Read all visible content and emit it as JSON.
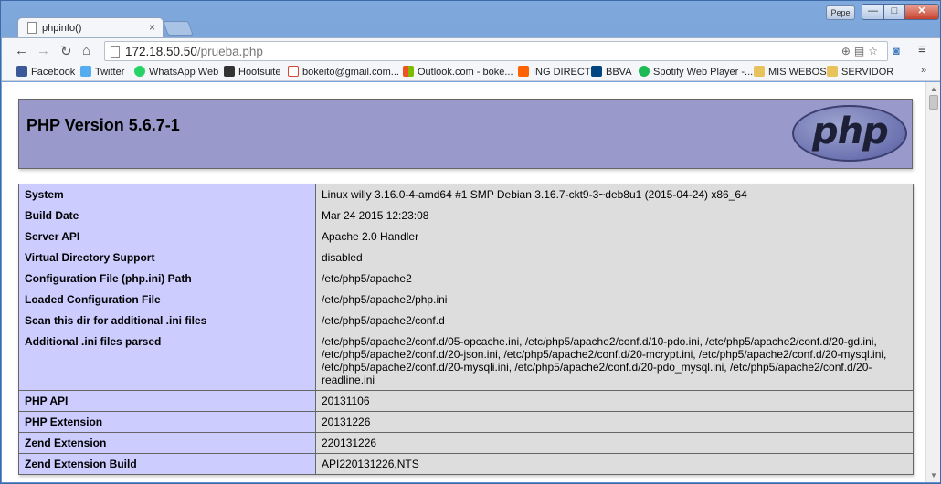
{
  "browser": {
    "tab": {
      "title": "phpinfo()",
      "close": "×"
    },
    "profile": "Pepe",
    "window_buttons": {
      "minimize": "—",
      "maximize": "□",
      "close": "✕"
    },
    "url": {
      "host": "172.18.50.50",
      "path": "/prueba.php"
    },
    "bookmarks": [
      {
        "label": "Facebook",
        "icon": "facebook-icon",
        "color": "#3b5998"
      },
      {
        "label": "Twitter",
        "icon": "twitter-icon",
        "color": "#55acee"
      },
      {
        "label": "WhatsApp Web",
        "icon": "whatsapp-icon",
        "color": "#25d366"
      },
      {
        "label": "Hootsuite",
        "icon": "hootsuite-icon",
        "color": "#333333"
      },
      {
        "label": "bokeito@gmail.com...",
        "icon": "gmail-icon",
        "color": "#d14836"
      },
      {
        "label": "Outlook.com - boke...",
        "icon": "outlook-icon",
        "color": "#f25022"
      },
      {
        "label": "ING DIRECT",
        "icon": "ing-icon",
        "color": "#ff6200"
      },
      {
        "label": "BBVA",
        "icon": "bbva-icon",
        "color": "#004481"
      },
      {
        "label": "Spotify Web Player -...",
        "icon": "spotify-icon",
        "color": "#1db954"
      },
      {
        "label": "MIS WEBOS",
        "icon": "folder-icon",
        "color": "#e8c25a"
      },
      {
        "label": "SERVIDOR",
        "icon": "folder-icon",
        "color": "#e8c25a"
      }
    ],
    "more": "»"
  },
  "page": {
    "php_version": "PHP Version 5.6.7-1",
    "logo_text": "php",
    "rows": [
      {
        "key": "System",
        "value": "Linux willy 3.16.0-4-amd64 #1 SMP Debian 3.16.7-ckt9-3~deb8u1 (2015-04-24) x86_64"
      },
      {
        "key": "Build Date",
        "value": "Mar 24 2015 12:23:08"
      },
      {
        "key": "Server API",
        "value": "Apache 2.0 Handler"
      },
      {
        "key": "Virtual Directory Support",
        "value": "disabled"
      },
      {
        "key": "Configuration File (php.ini) Path",
        "value": "/etc/php5/apache2"
      },
      {
        "key": "Loaded Configuration File",
        "value": "/etc/php5/apache2/php.ini"
      },
      {
        "key": "Scan this dir for additional .ini files",
        "value": "/etc/php5/apache2/conf.d"
      },
      {
        "key": "Additional .ini files parsed",
        "value": "/etc/php5/apache2/conf.d/05-opcache.ini, /etc/php5/apache2/conf.d/10-pdo.ini, /etc/php5/apache2/conf.d/20-gd.ini, /etc/php5/apache2/conf.d/20-json.ini, /etc/php5/apache2/conf.d/20-mcrypt.ini, /etc/php5/apache2/conf.d/20-mysql.ini, /etc/php5/apache2/conf.d/20-mysqli.ini, /etc/php5/apache2/conf.d/20-pdo_mysql.ini, /etc/php5/apache2/conf.d/20-readline.ini"
      },
      {
        "key": "PHP API",
        "value": "20131106"
      },
      {
        "key": "PHP Extension",
        "value": "20131226"
      },
      {
        "key": "Zend Extension",
        "value": "220131226"
      },
      {
        "key": "Zend Extension Build",
        "value": "API220131226,NTS"
      }
    ]
  }
}
